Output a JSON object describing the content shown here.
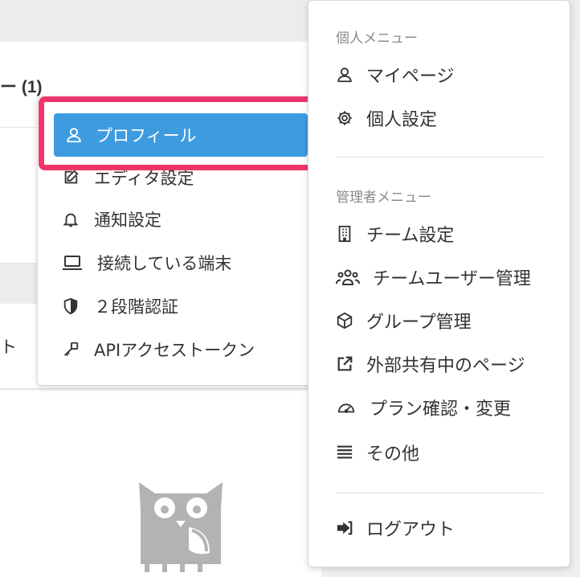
{
  "background": {
    "card_title": "ー (1)",
    "card2_text": "ト"
  },
  "left_menu": {
    "items": [
      {
        "label": "プロフィール",
        "icon": "user-icon"
      },
      {
        "label": "エディタ設定",
        "icon": "edit-icon"
      },
      {
        "label": "通知設定",
        "icon": "bell-icon"
      },
      {
        "label": "接続している端末",
        "icon": "laptop-icon"
      },
      {
        "label": "２段階認証",
        "icon": "shield-icon"
      },
      {
        "label": "APIアクセストークン",
        "icon": "key-icon"
      }
    ]
  },
  "right_menu": {
    "personal_label": "個人メニュー",
    "personal_items": [
      {
        "label": "マイページ",
        "icon": "user-icon"
      },
      {
        "label": "個人設定",
        "icon": "gear-icon"
      }
    ],
    "admin_label": "管理者メニュー",
    "admin_items": [
      {
        "label": "チーム設定",
        "icon": "building-icon"
      },
      {
        "label": "チームユーザー管理",
        "icon": "users-icon"
      },
      {
        "label": "グループ管理",
        "icon": "cube-icon"
      },
      {
        "label": "外部共有中のページ",
        "icon": "external-link-icon"
      },
      {
        "label": "プラン確認・変更",
        "icon": "gauge-icon"
      },
      {
        "label": "その他",
        "icon": "list-icon"
      }
    ],
    "logout_label": "ログアウト"
  },
  "colors": {
    "accent": "#3d9be0",
    "highlight": "#f0356b"
  }
}
